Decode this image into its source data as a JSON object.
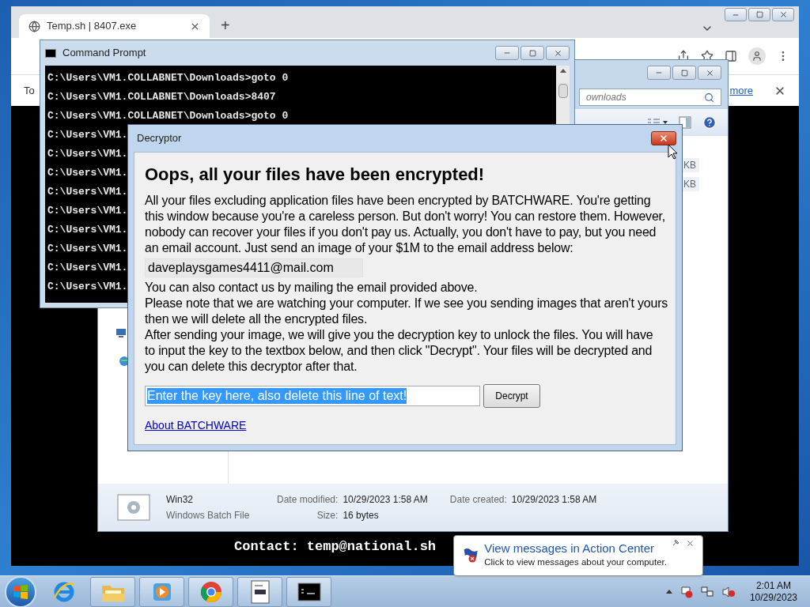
{
  "browser": {
    "tab_title": "Temp.sh | 8407.exe",
    "new_tab": "+",
    "infobar_text": "To",
    "infobar_link": "more",
    "page_text": "Contact: temp@national.sh"
  },
  "command_prompt": {
    "title": "Command Prompt",
    "lines": [
      "C:\\Users\\VM1.COLLABNET\\Downloads>goto 0",
      "C:\\Users\\VM1.COLLABNET\\Downloads>8407",
      "C:\\Users\\VM1.COLLABNET\\Downloads>goto 0",
      "C:\\Users\\VM1.",
      "C:\\Users\\VM1.",
      "C:\\Users\\VM1.",
      "C:\\Users\\VM1.",
      "C:\\Users\\VM1.",
      "C:\\Users\\VM1.",
      "C:\\Users\\VM1.",
      "C:\\Users\\VM1.",
      "C:\\Users\\VM1."
    ]
  },
  "explorer": {
    "search_placeholder": "ownloads",
    "sizes": [
      "KB",
      "KB"
    ],
    "details": {
      "name": "Win32",
      "type": "Windows Batch File",
      "fields": [
        {
          "label": "Date modified:",
          "value": "10/29/2023 1:58 AM"
        },
        {
          "label": "Date created:",
          "value": "10/29/2023 1:58 AM"
        },
        {
          "label": "Size:",
          "value": "16 bytes"
        }
      ]
    }
  },
  "decryptor": {
    "title": "Decryptor",
    "heading": "Oops, all your files have been encrypted!",
    "intro": "All your files excluding application files have been encrypted by BATCHWARE. You're getting this window because you're a careless person. But don't worry! You can restore them. However, nobody can recover your files if you don't pay us. Actually, you don't have to pay, but you need an email account. Just send an image of your $1M to the email address below:",
    "email": "daveplaysgames4411@mail.com",
    "paragraphs": [
      "You can also contact us by mailing the email provided above.",
      "Please note that we are watching your computer. If we see you sending images that aren't yours then we will delete all the encrypted files.",
      "After sending your image, we will give you the decryption key to unlock the files. You will have to input the key to the textbox below, and then click \"Decrypt\". Your files will be decrypted and you can delete this decryptor after that."
    ],
    "key_value": "Enter the key here, also delete this line of text!",
    "key_selected": true,
    "button": "Decrypt",
    "link": "About BATCHWARE"
  },
  "notification": {
    "title": "View messages in Action Center",
    "text": "Click to view messages about your computer."
  },
  "taskbar": {
    "items": [
      {
        "kind": "ie",
        "running": false
      },
      {
        "kind": "folder",
        "running": true
      },
      {
        "kind": "media",
        "running": true
      },
      {
        "kind": "chrome",
        "running": true
      },
      {
        "kind": "document",
        "running": true
      },
      {
        "kind": "terminal",
        "running": true
      }
    ]
  },
  "clock": {
    "time": "2:01 AM",
    "date": "10/29/2023"
  }
}
